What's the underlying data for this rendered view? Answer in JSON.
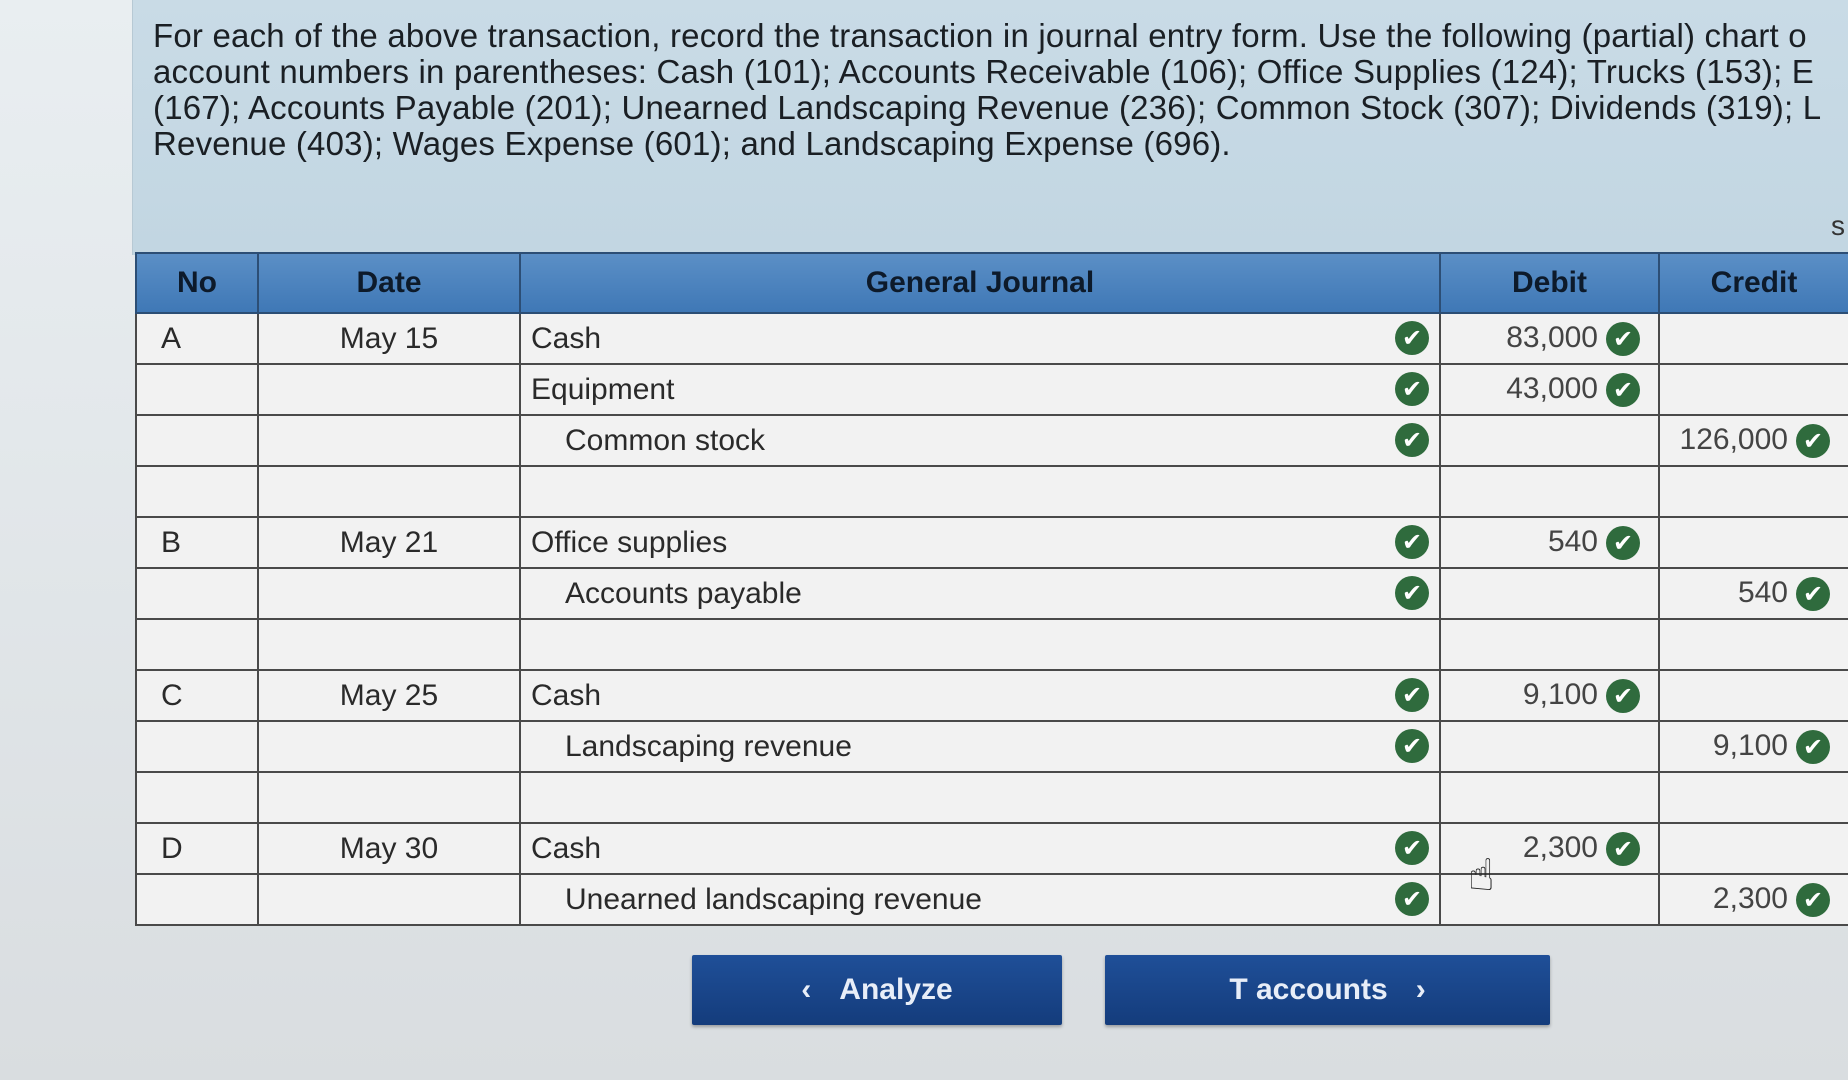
{
  "instructions": {
    "line1": "For each of the above transaction, record the transaction in journal entry form. Use the following (partial) chart o",
    "line2": "account numbers in parentheses: Cash (101); Accounts Receivable (106); Office Supplies (124); Trucks (153); E",
    "line3": "(167); Accounts Payable (201); Unearned Landscaping Revenue (236); Common Stock (307); Dividends (319); L",
    "line4": "Revenue (403); Wages Expense (601); and Landscaping Expense (696).",
    "edge_mark": "s"
  },
  "journal": {
    "headers": {
      "no": "No",
      "date": "Date",
      "general_journal": "General Journal",
      "debit": "Debit",
      "credit": "Credit"
    },
    "rows": [
      {
        "no": "A",
        "date": "May 15",
        "account": "Cash",
        "debit": "83,000",
        "credit": ""
      },
      {
        "no": "",
        "date": "",
        "account": "Equipment",
        "debit": "43,000",
        "credit": ""
      },
      {
        "no": "",
        "date": "",
        "account": "Common stock",
        "debit": "",
        "credit": "126,000"
      },
      {
        "no": "",
        "date": "",
        "account": "",
        "debit": "",
        "credit": ""
      },
      {
        "no": "B",
        "date": "May 21",
        "account": "Office supplies",
        "debit": "540",
        "credit": ""
      },
      {
        "no": "",
        "date": "",
        "account": "Accounts payable",
        "debit": "",
        "credit": "540"
      },
      {
        "no": "",
        "date": "",
        "account": "",
        "debit": "",
        "credit": ""
      },
      {
        "no": "C",
        "date": "May 25",
        "account": "Cash",
        "debit": "9,100",
        "credit": ""
      },
      {
        "no": "",
        "date": "",
        "account": "Landscaping revenue",
        "debit": "",
        "credit": "9,100"
      },
      {
        "no": "",
        "date": "",
        "account": "",
        "debit": "",
        "credit": ""
      },
      {
        "no": "D",
        "date": "May 30",
        "account": "Cash",
        "debit": "2,300",
        "credit": ""
      },
      {
        "no": "",
        "date": "",
        "account": "Unearned landscaping revenue",
        "debit": "",
        "credit": "2,300"
      }
    ],
    "check_icon": "check-circle-icon"
  },
  "buttons": {
    "analyze": "Analyze",
    "t_accounts": "T accounts"
  },
  "colors": {
    "header_blue": "#4a82bf",
    "button_blue": "#1a4689",
    "check_green": "#2f6b3d"
  }
}
